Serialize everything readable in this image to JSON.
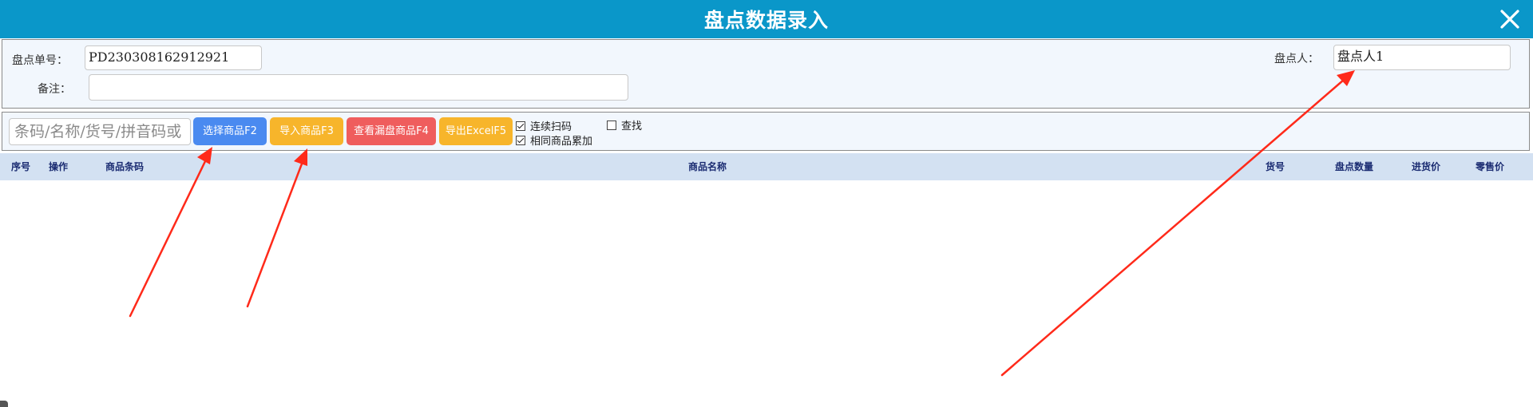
{
  "window": {
    "title": "盘点数据录入",
    "close_icon": "close-icon"
  },
  "form": {
    "order_no_label": "盘点单号：",
    "order_no_value": "PD230308162912921",
    "remark_label": "备注：",
    "remark_value": "",
    "counter_label": "盘点人：",
    "counter_value": "盘点人1"
  },
  "toolbar": {
    "search_placeholder": "条码/名称/货号/拼音码或",
    "buttons": [
      {
        "label": "选择商品F2",
        "color": "#4a8af0"
      },
      {
        "label": "导入商品F3",
        "color": "#f7b52b"
      },
      {
        "label": "查看漏盘商品F4",
        "color": "#ef5d5d"
      },
      {
        "label": "导出ExcelF5",
        "color": "#f7b52b"
      }
    ],
    "checkboxes": [
      {
        "label": "连续扫码",
        "checked": true
      },
      {
        "label": "相同商品累加",
        "checked": true
      },
      {
        "label": "查找",
        "checked": false
      }
    ]
  },
  "table": {
    "columns": [
      "序号",
      "操作",
      "商品条码",
      "商品名称",
      "货号",
      "盘点数量",
      "进货价",
      "零售价"
    ],
    "rows": []
  },
  "colors": {
    "title_bar": "#0a97c9",
    "panel_bg": "#f2f7fd",
    "header_bg": "#d3e1f2",
    "header_text": "#1b2c72",
    "annotation_arrow": "#ff2a1a"
  }
}
